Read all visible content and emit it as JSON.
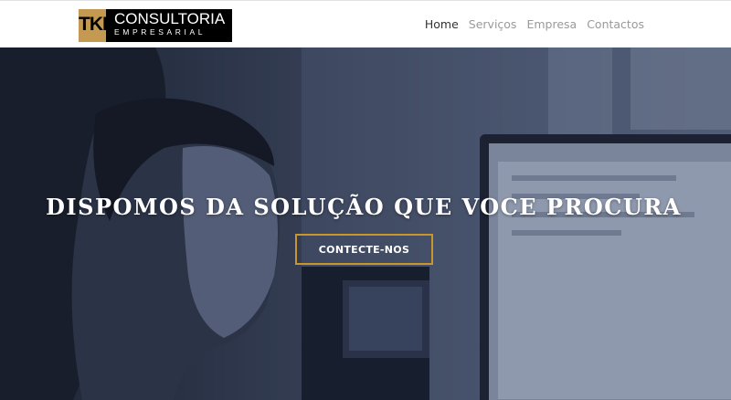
{
  "brand": {
    "mark": "TKI",
    "title": "CONSULTORIA",
    "subtitle": "EMPRESARIAL",
    "colors": {
      "gold": "#c49a52",
      "black": "#000000"
    }
  },
  "nav": {
    "items": [
      {
        "label": "Home",
        "active": true
      },
      {
        "label": "Serviços",
        "active": false
      },
      {
        "label": "Empresa",
        "active": false
      },
      {
        "label": "Contactos",
        "active": false
      }
    ]
  },
  "hero": {
    "title": "DISPOMOS DA SOLUÇÃO QUE VOCE PROCURA",
    "cta_label": "CONTECTE-NOS",
    "cta_border_color": "#c8962b"
  }
}
